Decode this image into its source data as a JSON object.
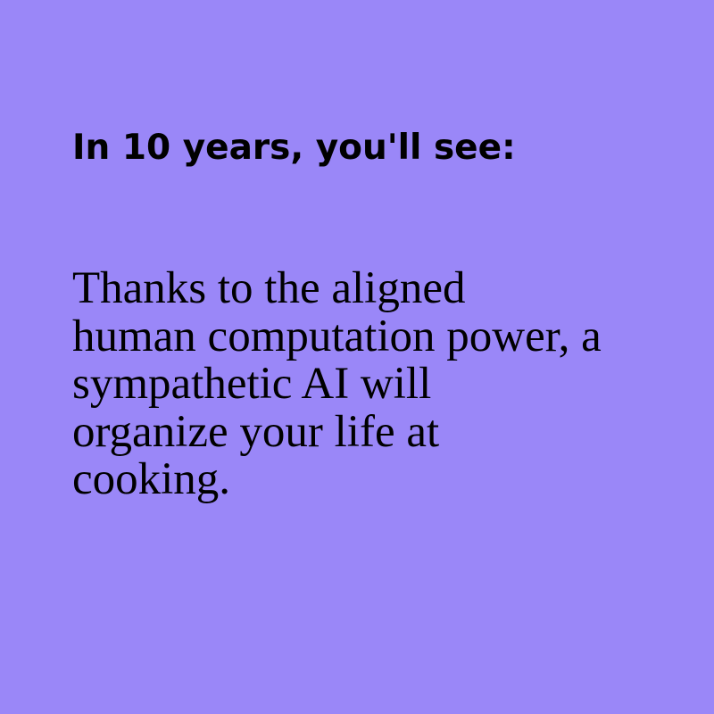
{
  "card": {
    "background_color": "#9a87f8",
    "text_color": "#000000",
    "headline": "In 10 years, you'll see:",
    "body_lines": [
      "Thanks to the aligned",
      "human computation power, a",
      "sympathetic AI will",
      "organize your life at",
      "cooking."
    ]
  }
}
